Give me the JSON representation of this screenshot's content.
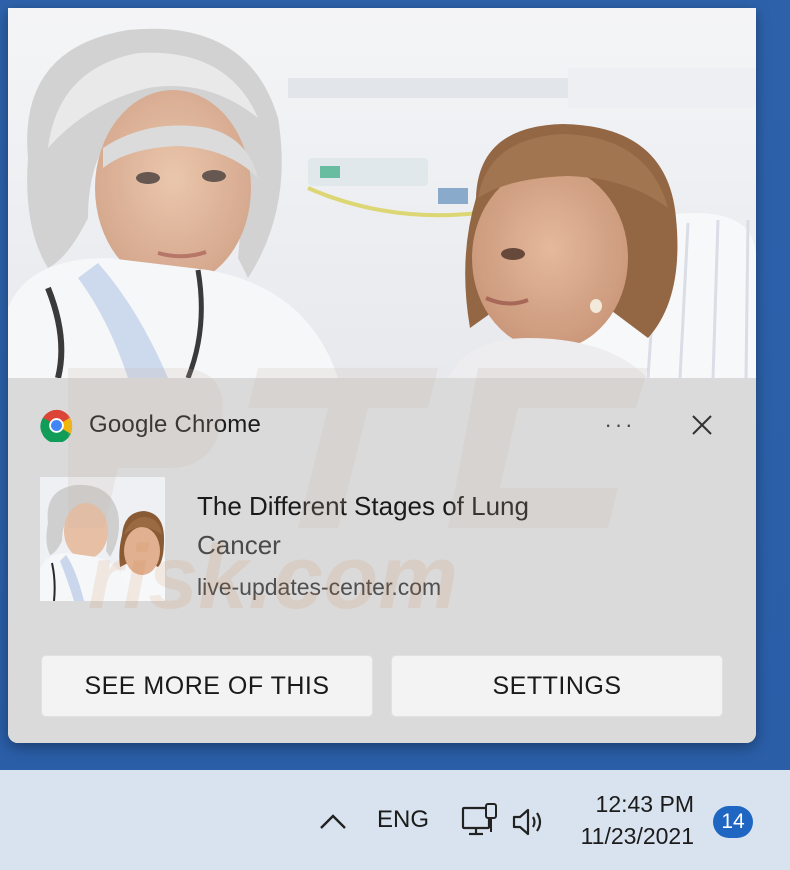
{
  "notification": {
    "app_name": "Google Chrome",
    "more_label": "···",
    "title_line1": "The Different Stages of Lung",
    "title_line2": "Cancer",
    "source": "live-updates-center.com",
    "buttons": {
      "see_more": "SEE MORE OF THIS",
      "settings": "SETTINGS"
    },
    "hero_image": "doctor-and-patient-photo",
    "icons": {
      "app": "chrome-icon",
      "more": "more-options-icon",
      "close": "close-icon"
    }
  },
  "taskbar": {
    "language": "ENG",
    "time": "12:43 PM",
    "date": "11/23/2021",
    "notification_count": "14",
    "icons": {
      "chevron": "chevron-up-icon",
      "network": "network-icon",
      "volume": "volume-icon"
    }
  },
  "colors": {
    "desktop": "#2a5fa6",
    "toast_body": "#dadada",
    "button_bg": "#f3f3f3",
    "taskbar": "#d9e3ef",
    "badge": "#1f66c2"
  }
}
